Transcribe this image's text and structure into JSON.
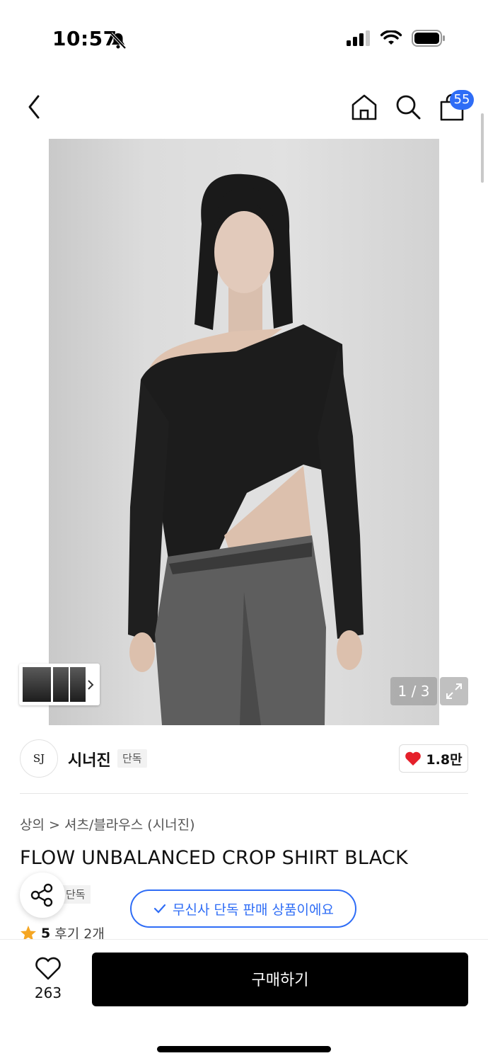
{
  "status_bar": {
    "time": "10:57"
  },
  "nav": {
    "cart_count": "55"
  },
  "gallery": {
    "page_counter": "1 / 3"
  },
  "brand": {
    "logo_text": "SJ",
    "name": "시너진",
    "exclusive_tag": "단독",
    "likes": "1.8만"
  },
  "product": {
    "breadcrumb": "상의 > 셔츠/블라우스 (시너진)",
    "title": "FLOW UNBALANCED CROP SHIRT BLACK",
    "exclusive_tag_partial": "단독",
    "exclusive_notice": "무신사 단독 판매 상품이에요",
    "rating": "5",
    "review_count": "후기 2개"
  },
  "bottom_bar": {
    "wishlist_count": "263",
    "buy_label": "구매하기"
  },
  "colors": {
    "accent": "#2f6df6",
    "heart": "#e5202a",
    "star": "#f5a623"
  }
}
